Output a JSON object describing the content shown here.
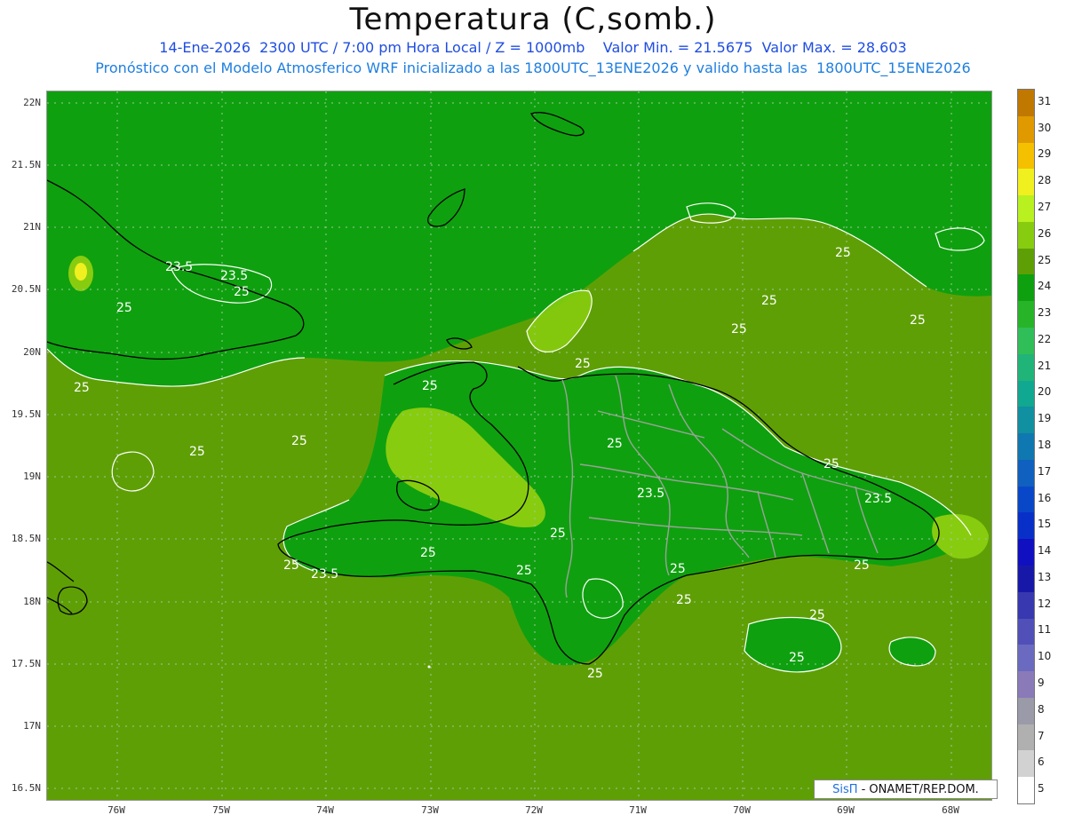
{
  "header": {
    "title": "Temperatura (C,somb.)",
    "line1": "14-Ene-2026  2300 UTC / 7:00 pm Hora Local / Z = 1000mb    Valor Min. = 21.5675  Valor Max. = 28.603",
    "line2": "Pronóstico con el Modelo Atmosferico WRF inicializado a las 1800UTC_13ENE2026 y valido hasta las  1800UTC_15ENE2026"
  },
  "axes": {
    "lat_labels": [
      "22N",
      "21.5N",
      "21N",
      "20.5N",
      "20N",
      "19.5N",
      "19N",
      "18.5N",
      "18N",
      "17.5N",
      "17N",
      "16.5N"
    ],
    "lon_labels": [
      "76W",
      "75W",
      "74W",
      "73W",
      "72W",
      "71W",
      "70W",
      "69W",
      "68W"
    ]
  },
  "contour_labels": [
    "23.5",
    "23.5",
    "25",
    "25",
    "25",
    "25",
    "25",
    "25",
    "25",
    "25",
    "25",
    "25",
    "25",
    "23.5",
    "25",
    "25",
    "25",
    "25",
    "23.5",
    "25",
    "25",
    "25",
    "25",
    "25",
    "25",
    "25",
    "23.5",
    "25"
  ],
  "colorbar": {
    "labels": [
      "31",
      "30",
      "29",
      "28",
      "27",
      "26",
      "25",
      "24",
      "23",
      "22",
      "21",
      "20",
      "19",
      "18",
      "17",
      "16",
      "15",
      "14",
      "13",
      "12",
      "11",
      "10",
      "9",
      "8",
      "7",
      "6",
      "5"
    ],
    "colors": [
      "#c07800",
      "#e09a00",
      "#f5c000",
      "#f0f020",
      "#b8f020",
      "#88cc10",
      "#5f9f06",
      "#0fa00f",
      "#28b428",
      "#30be58",
      "#20b478",
      "#10a890",
      "#1090a0",
      "#1078b0",
      "#1060c0",
      "#0848c8",
      "#0830c8",
      "#1010c0",
      "#1818a8",
      "#3838b0",
      "#5050b8",
      "#6a6ac0",
      "#8a7ab8",
      "#9a9aa8",
      "#b0b0b0",
      "#d2d2d2",
      "#ffffff"
    ]
  },
  "credit": {
    "brand": "SisΠ",
    "text": "- ONAMET/REP.DOM."
  }
}
